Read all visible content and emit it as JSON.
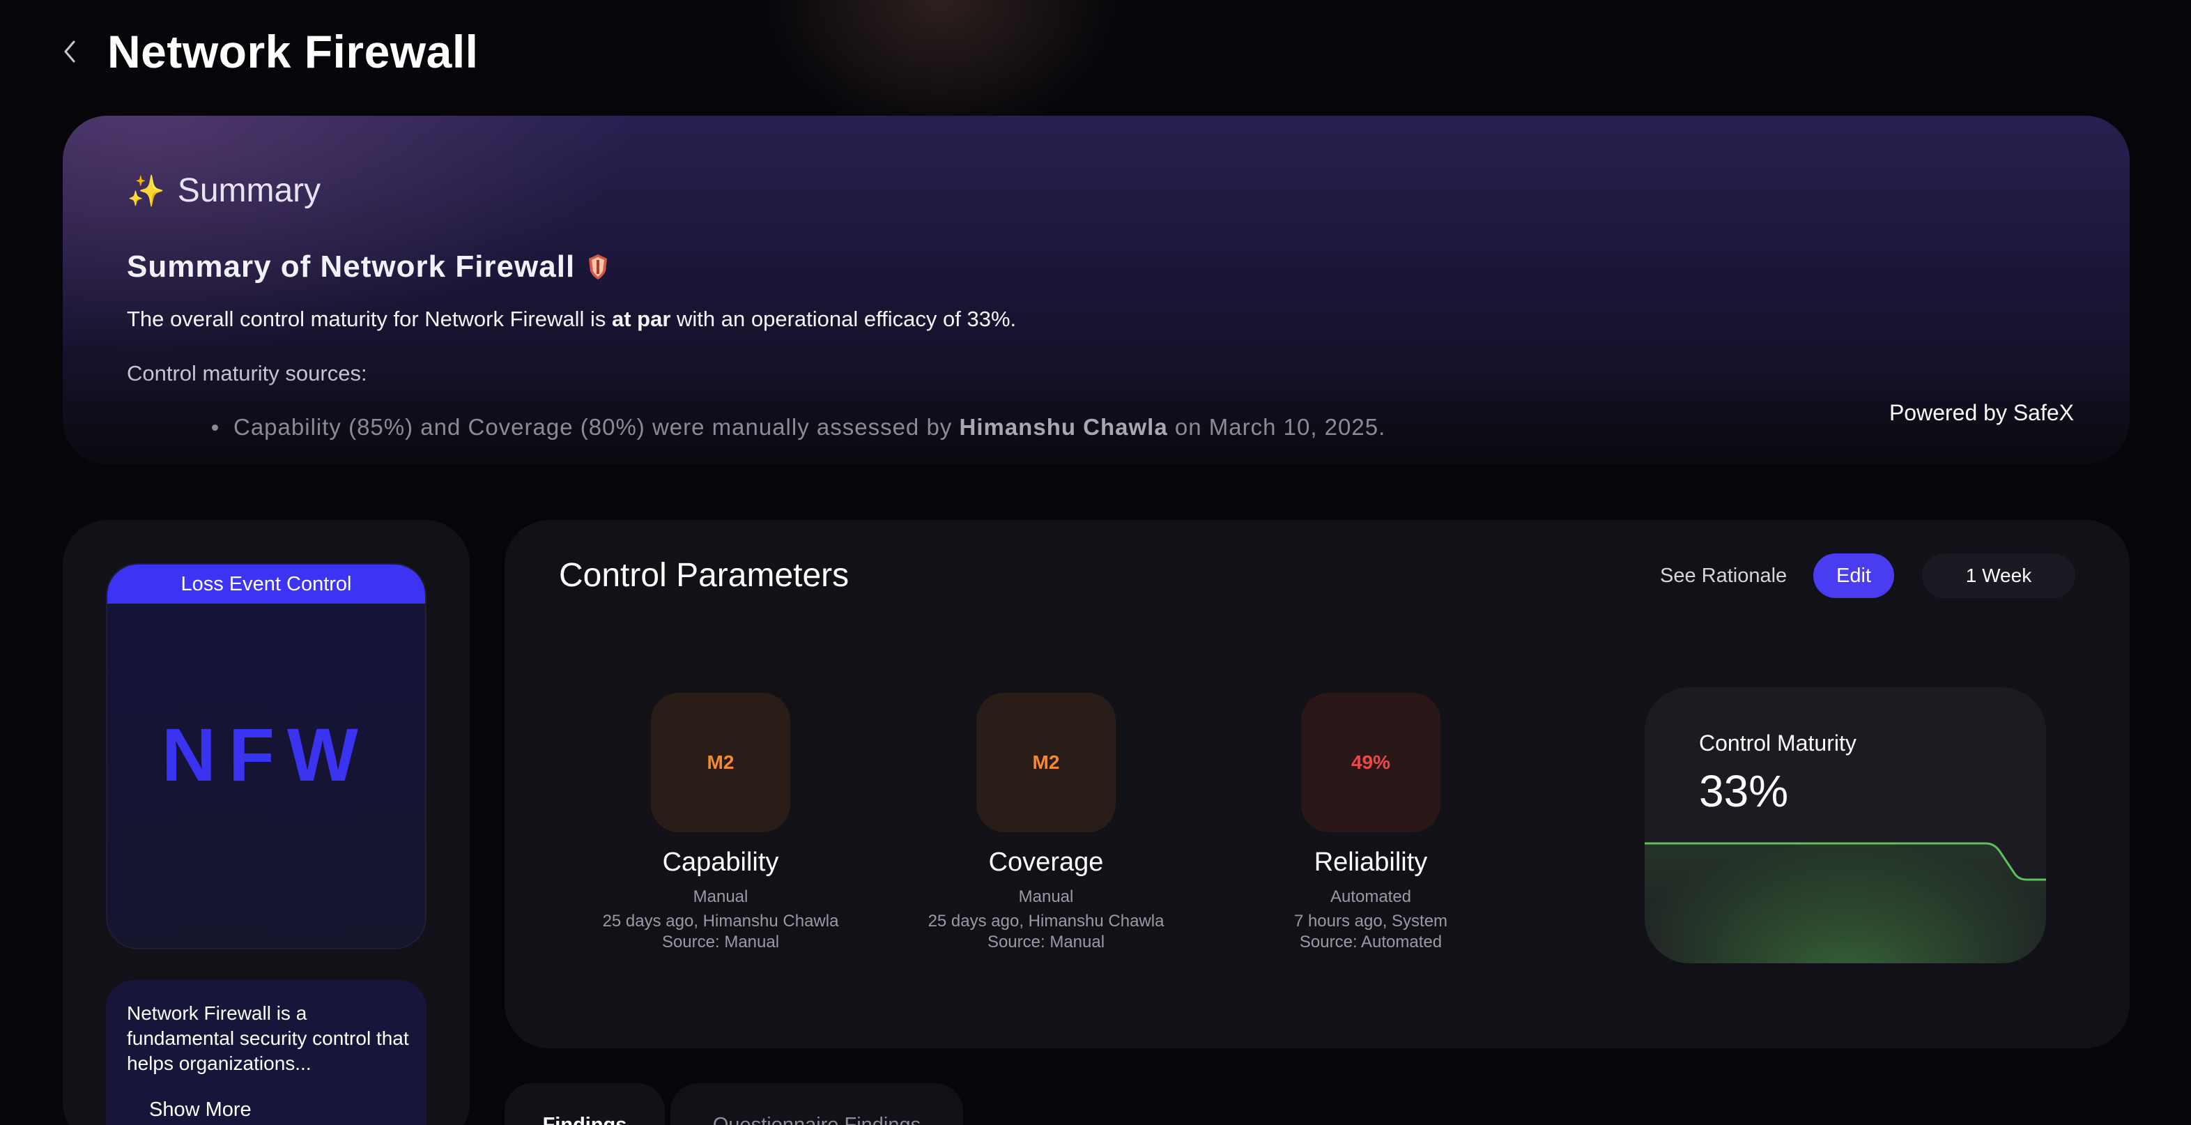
{
  "header": {
    "back_icon": "chevron-left-icon",
    "title": "Network Firewall"
  },
  "summary": {
    "heading": "Summary",
    "sparkle_icon": "sparkles-icon",
    "subtitle": "Summary of Network Firewall",
    "text_before": "The overall control maturity for Network Firewall is ",
    "text_bold": "at par",
    "text_after": " with an operational efficacy of 33%.",
    "sources_label": "Control maturity sources:",
    "source_item_before": "Capability (85%) and Coverage (80%) were manually assessed by ",
    "source_item_name": "Himanshu Chawla",
    "source_item_after": " on March 10, 2025.",
    "powered_by": "Powered by SafeX"
  },
  "control_card": {
    "tag": "Loss Event Control",
    "abbreviation": "NFW",
    "description": "Network Firewall is a fundamental security control that helps organizations...",
    "show_more": "Show More"
  },
  "control_parameters": {
    "title": "Control Parameters",
    "see_rationale": "See Rationale",
    "edit": "Edit",
    "period": "1 Week",
    "metrics": [
      {
        "value": "M2",
        "name": "Capability",
        "mode": "Manual",
        "updated": "25 days ago, Himanshu Chawla",
        "source": "Source: Manual",
        "color": "#f28a33"
      },
      {
        "value": "M2",
        "name": "Coverage",
        "mode": "Manual",
        "updated": "25 days ago, Himanshu Chawla",
        "source": "Source: Manual",
        "color": "#f28a33"
      },
      {
        "value": "49%",
        "name": "Reliability",
        "mode": "Automated",
        "updated": "7 hours ago, System",
        "source": "Source: Automated",
        "color": "#ec4848"
      }
    ],
    "maturity": {
      "label": "Control Maturity",
      "value": "33%",
      "line_color": "#5cc15a"
    }
  },
  "tabs": [
    {
      "label": "Findings",
      "active": true
    },
    {
      "label": "Questionnaire Findings",
      "active": false
    }
  ]
}
